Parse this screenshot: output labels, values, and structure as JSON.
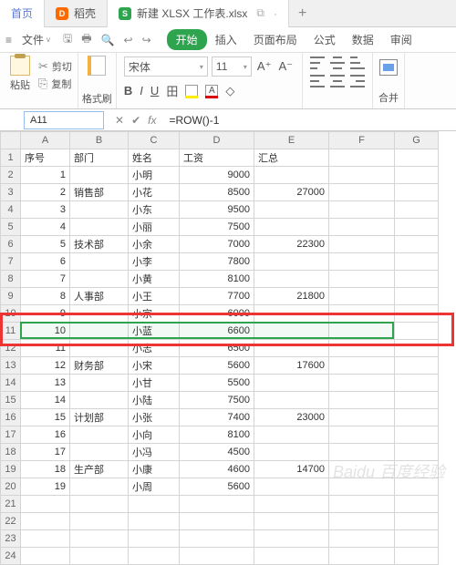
{
  "tabs": {
    "home": "首页",
    "daoke": "稻壳",
    "file": "新建 XLSX 工作表.xlsx",
    "dup": "⧉",
    "plus": "+"
  },
  "menu": {
    "file": "文件",
    "undo_glyphs": [
      "↩",
      "↪",
      "◂",
      "▸"
    ],
    "items": [
      "开始",
      "插入",
      "页面布局",
      "公式",
      "数据",
      "审阅"
    ]
  },
  "ribbon": {
    "paste": "粘贴",
    "cut": "剪切",
    "copy": "复制",
    "fmtbrush": "格式刷",
    "font_name": "宋体",
    "font_size": "11",
    "bold": "B",
    "italic": "I",
    "underline": "U",
    "border": "田",
    "textA": "A",
    "merge": "合并"
  },
  "fx": {
    "cellref": "A11",
    "formula": "=ROW()-1"
  },
  "cols": [
    "A",
    "B",
    "C",
    "D",
    "E",
    "F",
    "G"
  ],
  "headers": {
    "a": "序号",
    "b": "部门",
    "c": "姓名",
    "d": "工资",
    "e": "汇总"
  },
  "rows": [
    {
      "n": 1,
      "a": "序号",
      "b": "部门",
      "c": "姓名",
      "d": "工资",
      "e": "汇总",
      "hdr": true
    },
    {
      "n": 2,
      "a": "1",
      "b": "",
      "c": "小明",
      "d": "9000",
      "e": ""
    },
    {
      "n": 3,
      "a": "2",
      "b": "销售部",
      "c": "小花",
      "d": "8500",
      "e": "27000"
    },
    {
      "n": 4,
      "a": "3",
      "b": "",
      "c": "小东",
      "d": "9500",
      "e": ""
    },
    {
      "n": 5,
      "a": "4",
      "b": "",
      "c": "小丽",
      "d": "7500",
      "e": ""
    },
    {
      "n": 6,
      "a": "5",
      "b": "技术部",
      "c": "小余",
      "d": "7000",
      "e": "22300"
    },
    {
      "n": 7,
      "a": "6",
      "b": "",
      "c": "小李",
      "d": "7800",
      "e": ""
    },
    {
      "n": 8,
      "a": "7",
      "b": "",
      "c": "小黄",
      "d": "8100",
      "e": ""
    },
    {
      "n": 9,
      "a": "8",
      "b": "人事部",
      "c": "小王",
      "d": "7700",
      "e": "21800"
    },
    {
      "n": 10,
      "a": "9",
      "b": "",
      "c": "小宗",
      "d": "6000",
      "e": ""
    },
    {
      "n": 11,
      "a": "10",
      "b": "",
      "c": "小蓝",
      "d": "6600",
      "e": ""
    },
    {
      "n": 12,
      "a": "11",
      "b": "",
      "c": "小志",
      "d": "6500",
      "e": ""
    },
    {
      "n": 13,
      "a": "12",
      "b": "财务部",
      "c": "小宋",
      "d": "5600",
      "e": "17600"
    },
    {
      "n": 14,
      "a": "13",
      "b": "",
      "c": "小甘",
      "d": "5500",
      "e": ""
    },
    {
      "n": 15,
      "a": "14",
      "b": "",
      "c": "小陆",
      "d": "7500",
      "e": ""
    },
    {
      "n": 16,
      "a": "15",
      "b": "计划部",
      "c": "小张",
      "d": "7400",
      "e": "23000"
    },
    {
      "n": 17,
      "a": "16",
      "b": "",
      "c": "小向",
      "d": "8100",
      "e": ""
    },
    {
      "n": 18,
      "a": "17",
      "b": "",
      "c": "小冯",
      "d": "4500",
      "e": ""
    },
    {
      "n": 19,
      "a": "18",
      "b": "生产部",
      "c": "小康",
      "d": "4600",
      "e": "14700"
    },
    {
      "n": 20,
      "a": "19",
      "b": "",
      "c": "小周",
      "d": "5600",
      "e": ""
    },
    {
      "n": 21,
      "a": "",
      "b": "",
      "c": "",
      "d": "",
      "e": ""
    },
    {
      "n": 22,
      "a": "",
      "b": "",
      "c": "",
      "d": "",
      "e": ""
    },
    {
      "n": 23,
      "a": "",
      "b": "",
      "c": "",
      "d": "",
      "e": ""
    },
    {
      "n": 24,
      "a": "",
      "b": "",
      "c": "",
      "d": "",
      "e": ""
    }
  ],
  "watermark": "Baidu 百度经验"
}
